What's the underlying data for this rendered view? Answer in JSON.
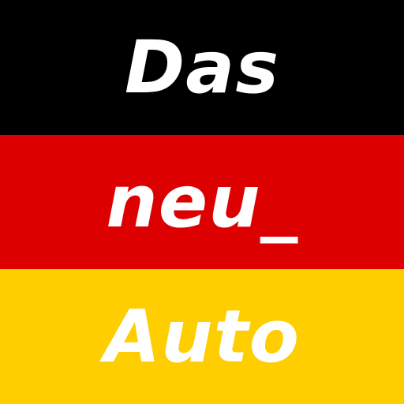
{
  "flag": {
    "colors": {
      "top": "#000000",
      "middle": "#DD0000",
      "bottom": "#FFCE00",
      "text": "#FFFFFF"
    },
    "lines": [
      "Das",
      "neu_",
      "Auto"
    ]
  }
}
